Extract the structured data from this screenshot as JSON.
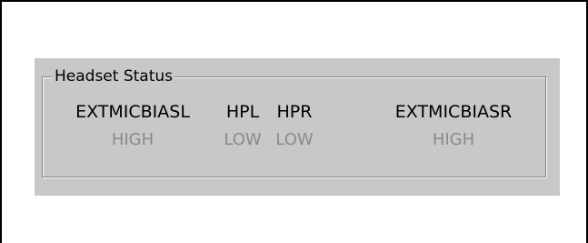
{
  "headset_status": {
    "title": "Headset Status",
    "signals": [
      {
        "name": "EXTMICBIASL",
        "value": "HIGH"
      },
      {
        "name": "HPL",
        "value": "LOW"
      },
      {
        "name": "HPR",
        "value": "LOW"
      },
      {
        "name": "EXTMICBIASR",
        "value": "HIGH"
      }
    ]
  },
  "colors": {
    "panel_background": "#c8c8c8",
    "label_text": "#000000",
    "value_text_disabled": "#8a8a8a"
  }
}
